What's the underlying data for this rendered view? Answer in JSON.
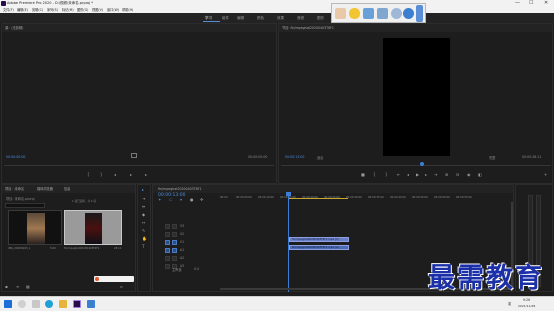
{
  "window": {
    "title": "Adobe Premiere Pro 2020 - D:\\视频\\未命名.prproj *",
    "controls": [
      "—",
      "☐",
      "✕"
    ]
  },
  "menu": {
    "items": [
      "文件(F)",
      "编辑(E)",
      "剪辑(C)",
      "序列(S)",
      "标记(M)",
      "图形(G)",
      "视图(V)",
      "窗口(W)",
      "帮助(H)"
    ]
  },
  "workspaces": {
    "tabs": [
      "学习",
      "组件",
      "编辑",
      "颜色",
      "效果",
      "音频",
      "图形",
      "库"
    ],
    "active": "学习"
  },
  "source_monitor": {
    "tab": "源：(无剪辑)",
    "timecode_left": "00:00:00:00",
    "timecode_right": "00:00:00:00"
  },
  "program_monitor": {
    "tab": "节目: fin/mpeghat20200403T6F1",
    "timecode_left": "00:00:13:00",
    "fit_label": "适合",
    "quality_label": "完整",
    "timecode_right": "00:00:28:11"
  },
  "project_panel": {
    "tabs": [
      "项目：未命名",
      "媒体浏览器",
      "信息"
    ],
    "bin_path": "项目: 未命名.prproj",
    "search_placeholder": "",
    "items": [
      {
        "name": "IMG_20200403_1",
        "duration": "5:00"
      },
      {
        "name": "fin/mpeghat20200403T6F1",
        "duration": "28:11"
      }
    ],
    "status_text": "1 项已选择，共 2 项"
  },
  "timeline": {
    "sequence_tab": "fin/mpeghat20200403T6F1",
    "timecode": "00:00:13:00",
    "ruler_labels": [
      "00:00",
      "00:00:05:00",
      "00:00:10:00",
      "00:00:15:00",
      "00:00:20:00",
      "00:00:25:00",
      "00:00:30:00",
      "00:00:35:00",
      "00:00:40:00",
      "00:00:45:00",
      "00:00:50:00",
      "00:00:55:00"
    ],
    "tracks": {
      "video": [
        "V3",
        "V2",
        "V1"
      ],
      "audio": [
        "A1",
        "A2",
        "A3"
      ],
      "master_label": "主声道",
      "master_value": "0.0"
    },
    "clips": {
      "video": "fin/mpeghat20200403T6F1.mp4 [V]",
      "audio": "fin/mpeghat20200403T6F1.mp4 [A]"
    }
  },
  "taskbar": {
    "time": "9:26",
    "date": "2021/11/28",
    "lang": "英"
  },
  "watermark": "最需教育",
  "colors": {
    "accent": "#4a8fe0",
    "playhead": "#3d7dd8",
    "clip_video": "#6a7fc8",
    "watermark": "#1a2fa8"
  },
  "floating_toolbar": {
    "icons": [
      "hand-icon",
      "speech-bubble-icon",
      "folder-icon",
      "screen-capture-icon",
      "zoom-icon",
      "help-icon",
      "pin-icon"
    ]
  }
}
